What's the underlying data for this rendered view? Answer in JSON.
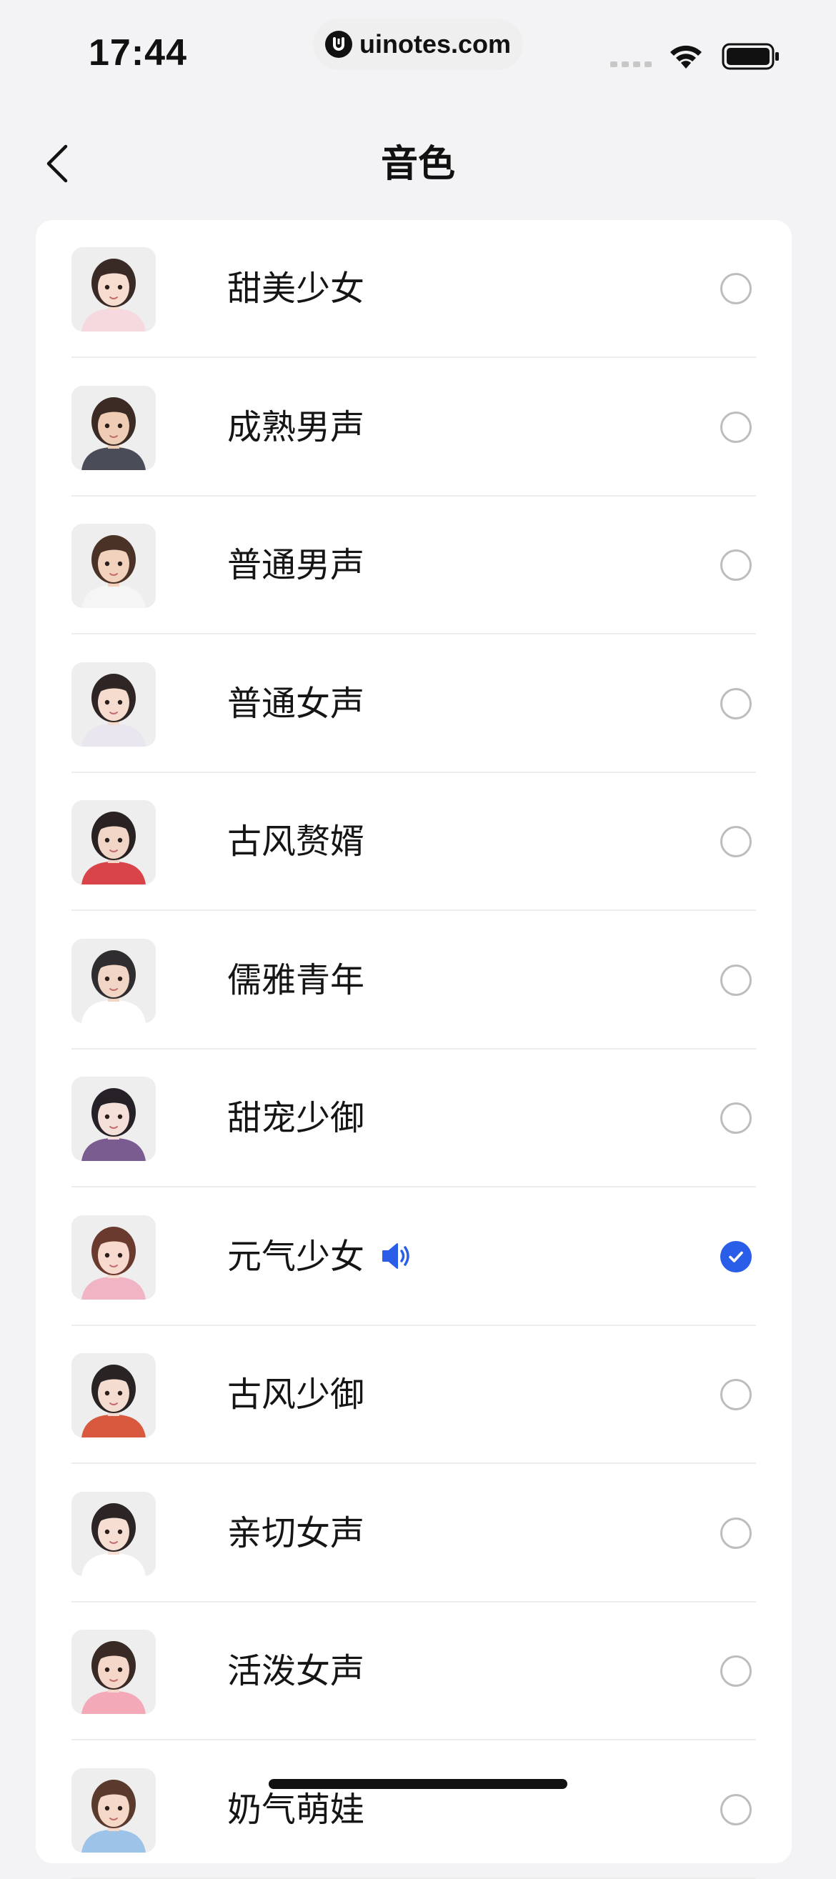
{
  "status_bar": {
    "time": "17:44",
    "url": "uinotes.com"
  },
  "nav": {
    "title": "音色"
  },
  "voices": [
    {
      "label": "甜美少女",
      "selected": false,
      "hair": "#3a2a26",
      "skin": "#f7dcd0",
      "cloth": "#f6d9de"
    },
    {
      "label": "成熟男声",
      "selected": false,
      "hair": "#3b2b24",
      "skin": "#efcdb5",
      "cloth": "#4a4d58"
    },
    {
      "label": "普通男声",
      "selected": false,
      "hair": "#4a3226",
      "skin": "#f2d2bd",
      "cloth": "#f5f5f5"
    },
    {
      "label": "普通女声",
      "selected": false,
      "hair": "#2e2524",
      "skin": "#f5dccf",
      "cloth": "#e9e6ef"
    },
    {
      "label": "古风赘婿",
      "selected": false,
      "hair": "#2a2222",
      "skin": "#f1d5c6",
      "cloth": "#d9434a"
    },
    {
      "label": "儒雅青年",
      "selected": false,
      "hair": "#2f2d30",
      "skin": "#f1d6c6",
      "cloth": "#ffffff"
    },
    {
      "label": "甜宠少御",
      "selected": false,
      "hair": "#252126",
      "skin": "#f4e0d8",
      "cloth": "#7a5c90"
    },
    {
      "label": "元气少女",
      "selected": true,
      "hair": "#6b3a2e",
      "skin": "#f7d9cd",
      "cloth": "#f0b4c4"
    },
    {
      "label": "古风少御",
      "selected": false,
      "hair": "#2a2324",
      "skin": "#f5dcd0",
      "cloth": "#d8593e"
    },
    {
      "label": "亲切女声",
      "selected": false,
      "hair": "#2c2425",
      "skin": "#f6ded3",
      "cloth": "#ffffff"
    },
    {
      "label": "活泼女声",
      "selected": false,
      "hair": "#3a2a26",
      "skin": "#f4d7c8",
      "cloth": "#f3a9b8"
    },
    {
      "label": "奶气萌娃",
      "selected": false,
      "hair": "#5a3a2c",
      "skin": "#f5d8c8",
      "cloth": "#9ec3e8"
    }
  ],
  "colors": {
    "accent": "#2a5de8",
    "background": "#f3f3f5",
    "card": "#ffffff"
  },
  "icons": {
    "back": "chevron-left-icon",
    "playing": "speaker-icon",
    "check": "check-icon"
  }
}
